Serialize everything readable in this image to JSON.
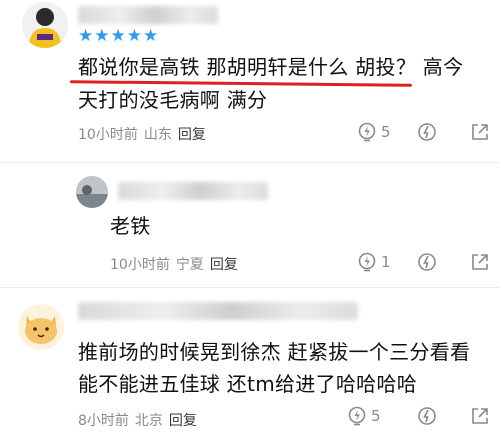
{
  "comments": [
    {
      "rating": 5,
      "text_line1": "都说你是高铁 那胡明轩是什么 胡投？ 高今",
      "text_line2": "天打的没毛病啊 满分",
      "time": "10小时前",
      "location": "山东",
      "reply_label": "回复",
      "likes": "5"
    },
    {
      "text": "老铁",
      "time": "10小时前",
      "location": "宁夏",
      "reply_label": "回复",
      "likes": "1"
    },
    {
      "text_line1": "推前场的时候晃到徐杰 赶紧拔一个三分看看",
      "text_line2": "能不能进五佳球 还tm给进了哈哈哈哈",
      "time": "8小时前",
      "location": "北京",
      "reply_label": "回复",
      "likes": "5"
    }
  ],
  "colors": {
    "accent_star": "#2f9bf0",
    "underline": "#e02020",
    "meta": "#8a8a8a"
  },
  "icons": [
    "like-bulb-icon",
    "dislike-bolt-icon",
    "share-icon"
  ]
}
